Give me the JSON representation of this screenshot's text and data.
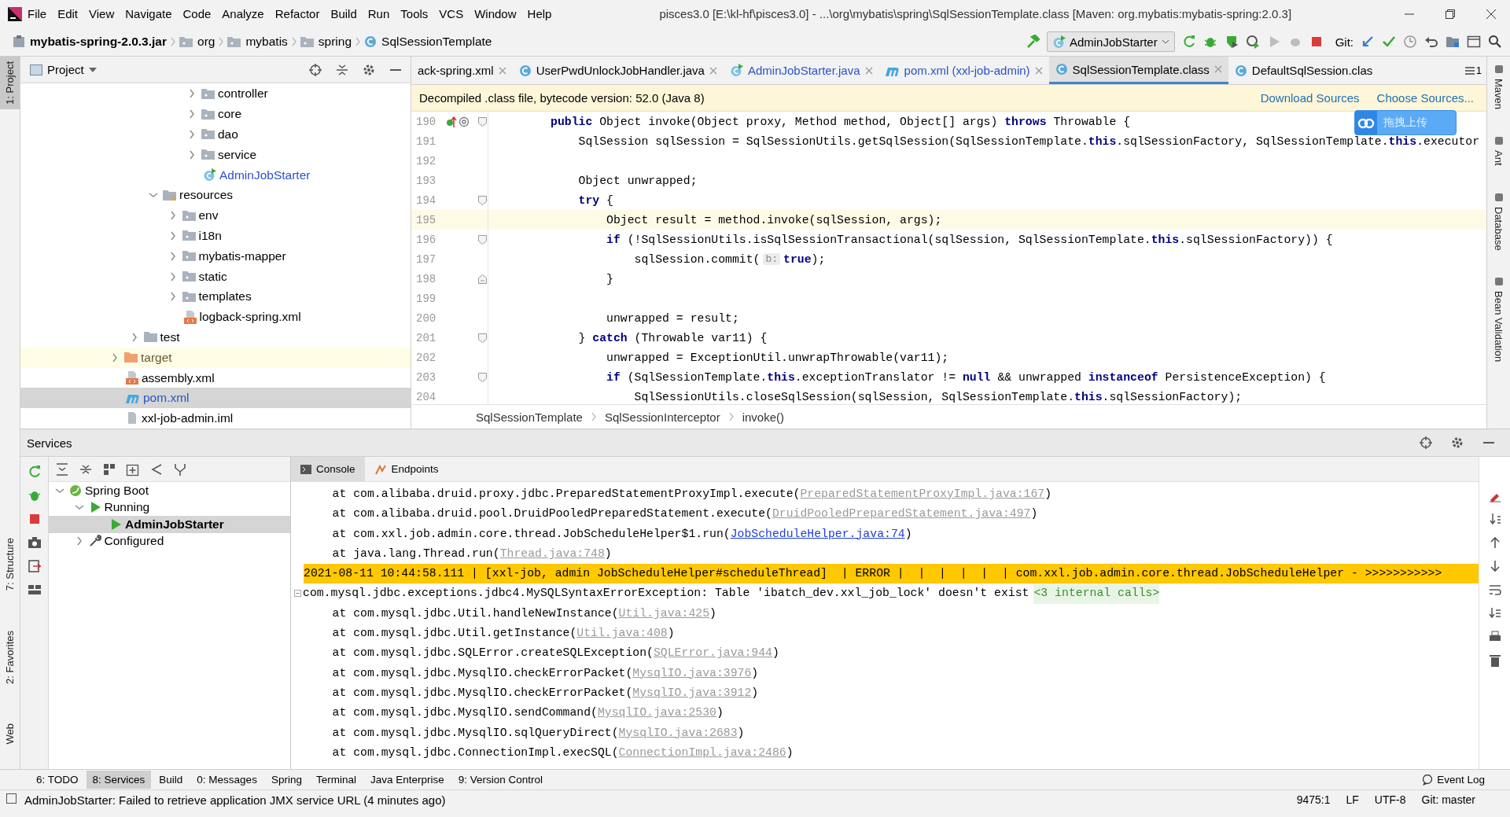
{
  "menu_bar": {
    "items": [
      "File",
      "Edit",
      "View",
      "Navigate",
      "Code",
      "Analyze",
      "Refactor",
      "Build",
      "Run",
      "Tools",
      "VCS",
      "Window",
      "Help"
    ],
    "title": "pisces3.0 [E:\\kl-hf\\pisces3.0] - ...\\org\\mybatis\\spring\\SqlSessionTemplate.class [Maven: org.mybatis:mybatis-spring:2.0.3]"
  },
  "nav_bar": {
    "breadcrumbs": [
      {
        "label": "mybatis-spring-2.0.3.jar",
        "kind": "jar"
      },
      {
        "label": "org",
        "kind": "package"
      },
      {
        "label": "mybatis",
        "kind": "package"
      },
      {
        "label": "spring",
        "kind": "package"
      },
      {
        "label": "SqlSessionTemplate",
        "kind": "class"
      }
    ],
    "run_config": "AdminJobStarter",
    "git_label": "Git:"
  },
  "left_strip": {
    "top": [
      {
        "label": "1: Project",
        "selected": true
      }
    ],
    "bottom": [
      {
        "label": "7: Structure",
        "selected": false
      },
      {
        "label": "2: Favorites",
        "selected": false
      },
      {
        "label": "Web",
        "selected": false
      }
    ]
  },
  "right_strip": [
    "Maven",
    "Ant",
    "Database",
    "Bean Validation"
  ],
  "project": {
    "title": "Project",
    "tree": [
      {
        "children": [
          {
            "children": [
              {
                "children": [
                  {
                    "children": [
                      {
                        "label": "controller",
                        "kind": "folder",
                        "expanded": false,
                        "selected": false,
                        "modified": false
                      },
                      {
                        "label": "core",
                        "kind": "folder",
                        "expanded": false,
                        "selected": false,
                        "modified": false
                      },
                      {
                        "label": "dao",
                        "kind": "folder",
                        "expanded": false,
                        "selected": false,
                        "modified": false
                      },
                      {
                        "label": "service",
                        "kind": "folder",
                        "expanded": false,
                        "selected": false,
                        "modified": false
                      },
                      {
                        "label": "AdminJobStarter",
                        "kind": "spring-class",
                        "selected": false,
                        "modified": true
                      }
                    ]
                  }
                ]
              },
              {
                "label": "resources",
                "kind": "resources-folder",
                "expanded": true,
                "selected": false,
                "modified": false,
                "children": [
                  {
                    "label": "env",
                    "kind": "folder",
                    "expanded": false,
                    "selected": false,
                    "modified": false
                  },
                  {
                    "label": "i18n",
                    "kind": "folder",
                    "expanded": false,
                    "selected": false,
                    "modified": false
                  },
                  {
                    "label": "mybatis-mapper",
                    "kind": "folder",
                    "expanded": false,
                    "selected": false,
                    "modified": false
                  },
                  {
                    "label": "static",
                    "kind": "folder",
                    "expanded": false,
                    "selected": false,
                    "modified": false
                  },
                  {
                    "label": "templates",
                    "kind": "folder",
                    "expanded": false,
                    "selected": false,
                    "modified": false
                  },
                  {
                    "label": "logback-spring.xml",
                    "kind": "xml",
                    "selected": false,
                    "modified": false
                  }
                ]
              }
            ]
          },
          {
            "label": "test",
            "kind": "test-folder",
            "expanded": false,
            "selected": false,
            "modified": false
          }
        ]
      },
      {
        "label": "target",
        "kind": "excluded-folder",
        "expanded": false,
        "selected": false,
        "modified": false
      },
      {
        "label": "assembly.xml",
        "kind": "xml",
        "selected": false,
        "modified": false
      },
      {
        "label": "pom.xml",
        "kind": "maven",
        "selected": true,
        "modified": true
      },
      {
        "label": "xxl-job-admin.iml",
        "kind": "iml",
        "selected": false,
        "modified": false
      }
    ]
  },
  "editor": {
    "tabs": [
      {
        "label": "ack-spring.xml",
        "selected": false,
        "modified": false,
        "closable": true
      },
      {
        "label": "UserPwdUnlockJobHandler.java",
        "kind": "class",
        "selected": false,
        "modified": false,
        "closable": true
      },
      {
        "label": "AdminJobStarter.java",
        "kind": "spring-class",
        "selected": false,
        "modified": true,
        "closable": true
      },
      {
        "label": "pom.xml (xxl-job-admin)",
        "kind": "maven",
        "selected": false,
        "modified": true,
        "closable": true
      },
      {
        "label": "SqlSessionTemplate.class",
        "kind": "class",
        "selected": true,
        "modified": false,
        "closable": true
      },
      {
        "label": "DefaultSqlSession.clas",
        "kind": "class",
        "selected": false,
        "modified": false,
        "closable": false
      }
    ],
    "hidden_tab_count": "1",
    "banner": {
      "text": "Decompiled .class file, bytecode version: 52.0 (Java 8)",
      "links": [
        "Download Sources",
        "Choose Sources..."
      ]
    },
    "lines": [
      {
        "number": "190",
        "current": false,
        "overrides": true,
        "fold_start": true,
        "fold_end": false,
        "segments": [
          {
            "kind": "code",
            "text": "        **public** Object invoke(Object proxy, Method method, Object[] args) **throws** Throwable {"
          }
        ]
      },
      {
        "number": "191",
        "current": false,
        "overrides": false,
        "fold_start": false,
        "fold_end": false,
        "segments": [
          {
            "kind": "code",
            "text": "            SqlSession sqlSession = SqlSessionUtils.getSqlSession(SqlSessionTemplate.**this**.sqlSessionFactory, SqlSessionTemplate.**this**.executor"
          }
        ]
      },
      {
        "number": "192",
        "current": false,
        "overrides": false,
        "fold_start": false,
        "fold_end": false
      },
      {
        "number": "193",
        "current": false,
        "overrides": false,
        "fold_start": false,
        "fold_end": false,
        "segments": [
          {
            "kind": "code",
            "text": "            Object unwrapped;"
          }
        ]
      },
      {
        "number": "194",
        "current": false,
        "overrides": false,
        "fold_start": true,
        "fold_end": false,
        "segments": [
          {
            "kind": "code",
            "text": "            **try** {"
          }
        ]
      },
      {
        "number": "195",
        "current": true,
        "overrides": false,
        "fold_start": false,
        "fold_end": false,
        "segments": [
          {
            "kind": "code",
            "text": "                Object result = method.invoke(sqlSession, args);"
          }
        ]
      },
      {
        "number": "196",
        "current": false,
        "overrides": false,
        "fold_start": true,
        "fold_end": false,
        "segments": [
          {
            "kind": "code",
            "text": "                **if** (!SqlSessionUtils.isSqlSessionTransactional(sqlSession, SqlSessionTemplate.**this**.sqlSessionFactory)) {"
          }
        ]
      },
      {
        "number": "197",
        "current": false,
        "overrides": false,
        "fold_start": false,
        "fold_end": false,
        "segments": [
          {
            "kind": "code",
            "text": "                    sqlSession.commit("
          },
          {
            "kind": "hint",
            "text": "b:"
          },
          {
            "kind": "code",
            "text": "**true**);"
          }
        ]
      },
      {
        "number": "198",
        "current": false,
        "overrides": false,
        "fold_start": false,
        "fold_end": true,
        "segments": [
          {
            "kind": "code",
            "text": "                }"
          }
        ]
      },
      {
        "number": "199",
        "current": false,
        "overrides": false,
        "fold_start": false,
        "fold_end": false
      },
      {
        "number": "200",
        "current": false,
        "overrides": false,
        "fold_start": false,
        "fold_end": false,
        "segments": [
          {
            "kind": "code",
            "text": "                unwrapped = result;"
          }
        ]
      },
      {
        "number": "201",
        "current": false,
        "overrides": false,
        "fold_start": true,
        "fold_end": false,
        "segments": [
          {
            "kind": "code",
            "text": "            } **catch** (Throwable var11) {"
          }
        ]
      },
      {
        "number": "202",
        "current": false,
        "overrides": false,
        "fold_start": false,
        "fold_end": false,
        "segments": [
          {
            "kind": "code",
            "text": "                unwrapped = ExceptionUtil.unwrapThrowable(var11);"
          }
        ]
      },
      {
        "number": "203",
        "current": false,
        "overrides": false,
        "fold_start": true,
        "fold_end": false,
        "segments": [
          {
            "kind": "code",
            "text": "                **if** (SqlSessionTemplate.**this**.exceptionTranslator != **null** && unwrapped **instanceof** PersistenceException) {"
          }
        ]
      },
      {
        "number": "204",
        "current": false,
        "overrides": false,
        "fold_start": false,
        "fold_end": false,
        "segments": [
          {
            "kind": "code",
            "text": "                    SqlSessionUtils.closeSqlSession(sqlSession, SqlSessionTemplate.**this**.sqlSessionFactory);"
          }
        ]
      }
    ],
    "breadcrumbs": [
      "SqlSessionTemplate",
      "SqlSessionInterceptor",
      "invoke()"
    ]
  },
  "upload_widget": {
    "label": "拖拽上传"
  },
  "services": {
    "title": "Services",
    "tree": [
      {
        "label": "Spring Boot",
        "kind": "spring-boot",
        "expanded": true,
        "selected": false,
        "modified": false,
        "children": [
          {
            "label": "Running",
            "kind": "running",
            "expanded": true,
            "selected": false,
            "modified": false,
            "children": [
              {
                "label": "AdminJobStarter",
                "kind": "app",
                "selected": true,
                "modified": false
              }
            ]
          },
          {
            "label": "Configured",
            "kind": "configured",
            "expanded": false,
            "selected": false,
            "modified": false
          }
        ]
      }
    ],
    "console_tabs": [
      {
        "label": "Console",
        "kind": "console",
        "selected": true
      },
      {
        "label": "Endpoints",
        "kind": "endpoints",
        "selected": false
      }
    ],
    "console": [
      {
        "kind": "trace",
        "text": "    at com.alibaba.druid.proxy.jdbc.PreparedStatementProxyImpl.execute(",
        "link": "PreparedStatementProxyImpl.java:167",
        "library": true,
        "suffix": ")"
      },
      {
        "kind": "trace",
        "text": "    at com.alibaba.druid.pool.DruidPooledPreparedStatement.execute(",
        "link": "DruidPooledPreparedStatement.java:497",
        "library": true,
        "suffix": ")"
      },
      {
        "kind": "trace",
        "text": "    at com.xxl.job.admin.core.thread.JobScheduleHelper$1.run(",
        "link": "JobScheduleHelper.java:74",
        "library": false,
        "suffix": ")"
      },
      {
        "kind": "trace",
        "text": "    at java.lang.Thread.run(",
        "link": "Thread.java:748",
        "library": true,
        "suffix": ")"
      },
      {
        "kind": "error",
        "text": "2021-08-11 10:44:58.111 | [xxl-job, admin JobScheduleHelper#scheduleThread]  | ERROR |  |  |  |  |  | com.xxl.job.admin.core.thread.JobScheduleHelper - >>>>>>>>>>>"
      },
      {
        "kind": "exception",
        "text": "com.mysql.jdbc.exceptions.jdbc4.MySQLSyntaxErrorException: Table 'ibatch_dev.xxl_job_lock' doesn't exist",
        "badge": "<3 internal calls>"
      },
      {
        "kind": "trace",
        "text": "    at com.mysql.jdbc.Util.handleNewInstance(",
        "link": "Util.java:425",
        "library": true,
        "suffix": ")"
      },
      {
        "kind": "trace",
        "text": "    at com.mysql.jdbc.Util.getInstance(",
        "link": "Util.java:408",
        "library": true,
        "suffix": ")"
      },
      {
        "kind": "trace",
        "text": "    at com.mysql.jdbc.SQLError.createSQLException(",
        "link": "SQLError.java:944",
        "library": true,
        "suffix": ")"
      },
      {
        "kind": "trace",
        "text": "    at com.mysql.jdbc.MysqlIO.checkErrorPacket(",
        "link": "MysqlIO.java:3976",
        "library": true,
        "suffix": ")"
      },
      {
        "kind": "trace",
        "text": "    at com.mysql.jdbc.MysqlIO.checkErrorPacket(",
        "link": "MysqlIO.java:3912",
        "library": true,
        "suffix": ")"
      },
      {
        "kind": "trace",
        "text": "    at com.mysql.jdbc.MysqlIO.sendCommand(",
        "link": "MysqlIO.java:2530",
        "library": true,
        "suffix": ")"
      },
      {
        "kind": "trace",
        "text": "    at com.mysql.jdbc.MysqlIO.sqlQueryDirect(",
        "link": "MysqlIO.java:2683",
        "library": true,
        "suffix": ")"
      },
      {
        "kind": "trace",
        "text": "    at com.mysql.jdbc.ConnectionImpl.execSQL(",
        "link": "ConnectionImpl.java:2486",
        "library": true,
        "suffix": ")"
      }
    ]
  },
  "tool_windows": [
    {
      "label": "6: TODO",
      "selected": false
    },
    {
      "label": "8: Services",
      "selected": true
    },
    {
      "label": "Build",
      "selected": false
    },
    {
      "label": "0: Messages",
      "selected": false
    },
    {
      "label": "Spring",
      "selected": false
    },
    {
      "label": "Terminal",
      "selected": false
    },
    {
      "label": "Java Enterprise",
      "selected": false
    },
    {
      "label": "9: Version Control",
      "selected": false
    }
  ],
  "event_log": "Event Log",
  "status_bar": {
    "message": "AdminJobStarter: Failed to retrieve application JMX service URL (4 minutes ago)",
    "position": "9475:1",
    "line_separator": "LF",
    "encoding": "UTF-8",
    "vcs": "Git: master"
  }
}
